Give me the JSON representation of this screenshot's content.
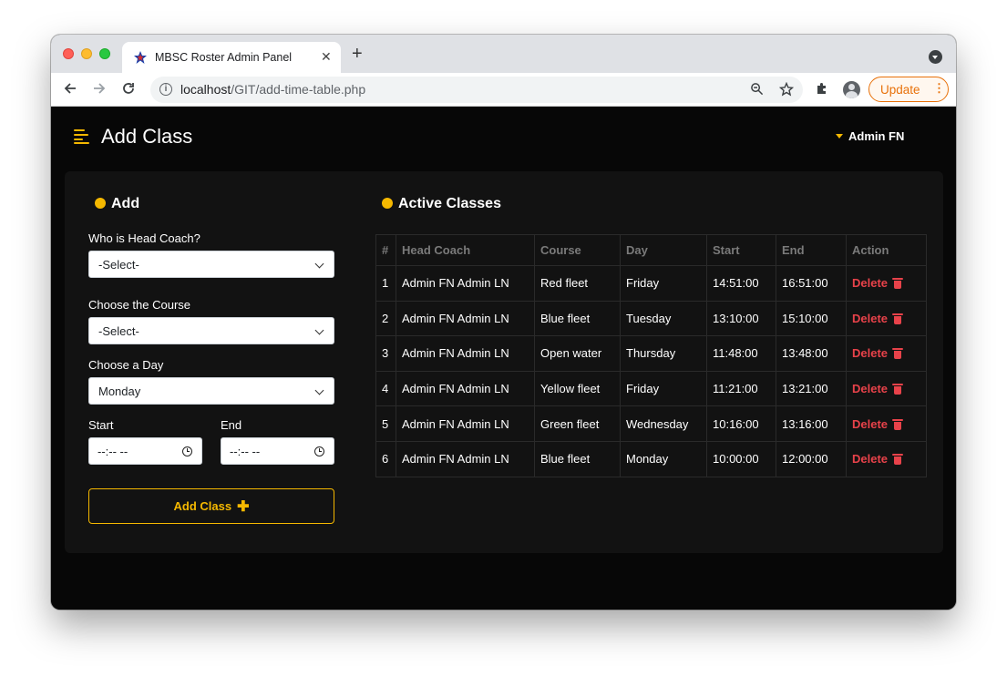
{
  "browser": {
    "tab_title": "MBSC Roster Admin Panel",
    "tab_close": "✕",
    "new_tab": "+",
    "url_host": "localhost",
    "url_path": "/GIT/add-time-table.php",
    "update_label": "Update"
  },
  "header": {
    "title": "Add Class",
    "user": "Admin FN"
  },
  "add_form": {
    "section_title": "Add",
    "coach_label": "Who is Head Coach?",
    "coach_value": "-Select-",
    "course_label": "Choose the Course",
    "course_value": "-Select-",
    "day_label": "Choose a Day",
    "day_value": "Monday",
    "start_label": "Start",
    "start_value": "--:-- --",
    "end_label": "End",
    "end_value": "--:-- --",
    "submit_label": "Add Class"
  },
  "classes": {
    "section_title": "Active Classes",
    "columns": [
      "#",
      "Head Coach",
      "Course",
      "Day",
      "Start",
      "End",
      "Action"
    ],
    "delete_label": "Delete",
    "rows": [
      {
        "num": "1",
        "coach": "Admin FN Admin LN",
        "course": "Red fleet",
        "day": "Friday",
        "start": "14:51:00",
        "end": "16:51:00"
      },
      {
        "num": "2",
        "coach": "Admin FN Admin LN",
        "course": "Blue fleet",
        "day": "Tuesday",
        "start": "13:10:00",
        "end": "15:10:00"
      },
      {
        "num": "3",
        "coach": "Admin FN Admin LN",
        "course": "Open water",
        "day": "Thursday",
        "start": "11:48:00",
        "end": "13:48:00"
      },
      {
        "num": "4",
        "coach": "Admin FN Admin LN",
        "course": "Yellow fleet",
        "day": "Friday",
        "start": "11:21:00",
        "end": "13:21:00"
      },
      {
        "num": "5",
        "coach": "Admin FN Admin LN",
        "course": "Green fleet",
        "day": "Wednesday",
        "start": "10:16:00",
        "end": "13:16:00"
      },
      {
        "num": "6",
        "coach": "Admin FN Admin LN",
        "course": "Blue fleet",
        "day": "Monday",
        "start": "10:00:00",
        "end": "12:00:00"
      }
    ]
  },
  "colors": {
    "accent": "#f5b800",
    "danger": "#e8424a",
    "background": "#070707",
    "panel": "#121212"
  }
}
